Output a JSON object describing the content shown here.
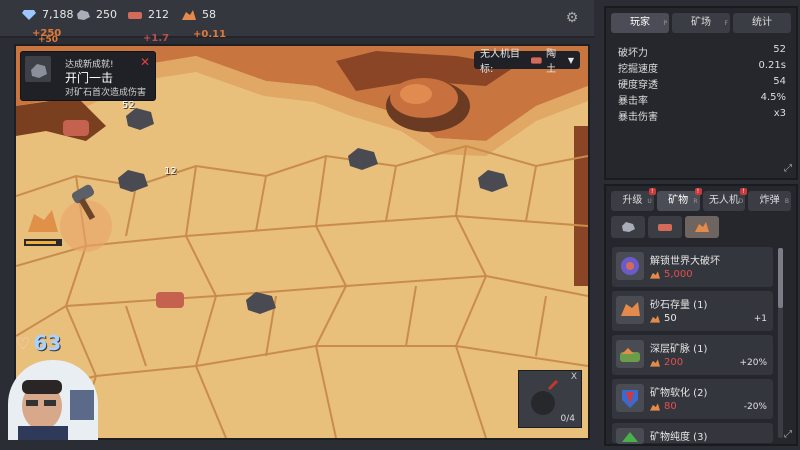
{
  "resources": [
    {
      "name": "gem",
      "value": "7,188",
      "color": "#9ec6ff"
    },
    {
      "name": "iron",
      "value": "250",
      "color": "#a8adb8"
    },
    {
      "name": "clay",
      "value": "212",
      "color": "#d46a5a"
    },
    {
      "name": "copper",
      "value": "58",
      "color": "#e48a4a"
    }
  ],
  "gains": [
    "+250",
    "+50",
    "+1.7",
    "+0.11"
  ],
  "toast": {
    "title": "达成新成就!",
    "name": "开门一击",
    "desc": "对矿石首次造成伤害"
  },
  "drone_target": {
    "label": "无人机目标:",
    "value": "陶土"
  },
  "floating_numbers": [
    "52",
    "12"
  ],
  "hp": "63",
  "minimap_count": "0/4",
  "minimap_close": "X",
  "player_panel": {
    "tabs": [
      {
        "label": "玩家",
        "key": "P"
      },
      {
        "label": "矿场",
        "key": "F"
      },
      {
        "label": "统计",
        "key": ""
      }
    ],
    "stats": [
      {
        "label": "破坏力",
        "value": "52"
      },
      {
        "label": "挖掘速度",
        "value": "0.21s"
      },
      {
        "label": "硬度穿透",
        "value": "54"
      },
      {
        "label": "暴击率",
        "value": "4.5%"
      },
      {
        "label": "暴击伤害",
        "value": "x3"
      }
    ]
  },
  "shop_panel": {
    "tabs": [
      {
        "label": "升级",
        "key": "U"
      },
      {
        "label": "矿物",
        "key": "R"
      },
      {
        "label": "无人机",
        "key": "D"
      },
      {
        "label": "炸弹",
        "key": "B"
      }
    ],
    "cards": [
      {
        "name": "解锁世界大破坏",
        "cost": "5,000",
        "effect": "",
        "cost_color": "#e05050"
      },
      {
        "name": "砂石存量 (1)",
        "cost": "50",
        "effect": "+1",
        "cost_color": "#e6e6e6"
      },
      {
        "name": "深层矿脉 (1)",
        "cost": "200",
        "effect": "+20%",
        "cost_color": "#e05050"
      },
      {
        "name": "矿物软化 (2)",
        "cost": "80",
        "effect": "-20%",
        "cost_color": "#e05050"
      },
      {
        "name": "矿物纯度 (3)",
        "cost": "",
        "effect": "",
        "cost_color": "#e6e6e6"
      }
    ]
  }
}
